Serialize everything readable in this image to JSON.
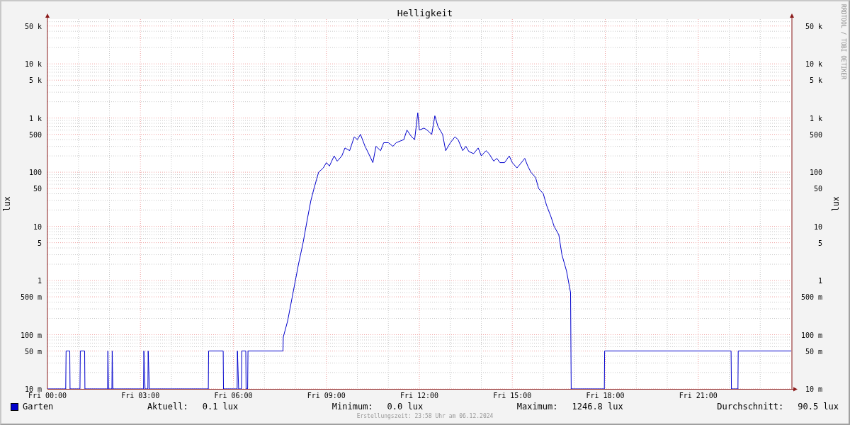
{
  "chart": {
    "title": "Helligkeit",
    "left_axis_title": "lux",
    "right_axis_title": "lux",
    "left_tick_labels": [
      "50 k",
      "10 k",
      "5 k",
      "1 k",
      "500",
      "100",
      "50",
      "10",
      "5",
      "1",
      "500 m",
      "100 m",
      "50 m",
      "10 m"
    ],
    "right_tick_labels": [
      "50 k",
      "10 k",
      "5 k",
      "1 k",
      "500",
      "100",
      "50",
      "10",
      "5",
      "1",
      "500 m",
      "100 m",
      "50 m",
      "10 m"
    ],
    "x_tick_labels": [
      "Fri 00:00",
      "Fri 03:00",
      "Fri 06:00",
      "Fri 09:00",
      "Fri 12:00",
      "Fri 15:00",
      "Fri 18:00",
      "Fri 21:00"
    ]
  },
  "watermark": "RRDTOOL / TOBI OETIKER",
  "legend": {
    "name": "Garten",
    "color": "#0000cc"
  },
  "stats": [
    {
      "label": "Aktuell:",
      "value": "0.1 lux"
    },
    {
      "label": "Minimum:",
      "value": "0.0 lux"
    },
    {
      "label": "Maximum:",
      "value": "1246.8 lux"
    },
    {
      "label": "Durchschnitt:",
      "value": "90.5 lux"
    }
  ],
  "footer": "Erstellungszeit: 23:58 Uhr am 06.12.2024"
}
